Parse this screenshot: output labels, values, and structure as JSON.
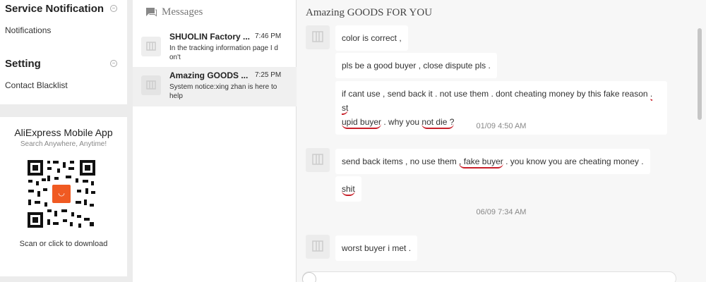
{
  "sidebar": {
    "service": {
      "title": "Service Notification",
      "link": "Notifications"
    },
    "setting": {
      "title": "Setting",
      "link": "Contact Blacklist"
    },
    "app": {
      "title": "AliExpress Mobile App",
      "subtitle": "Search Anywhere, Anytime!",
      "download": "Scan or click to download"
    }
  },
  "messages": {
    "title": "Messages",
    "conversations": [
      {
        "name": "SHUOLIN Factory ...",
        "time": "7:46 PM",
        "preview": "In the tracking information page I d on't"
      },
      {
        "name": "Amazing GOODS ...",
        "time": "7:25 PM",
        "preview": "System notice:xing zhan is here to help"
      }
    ]
  },
  "chat": {
    "title": "Amazing GOODS FOR YOU",
    "messages": [
      {
        "text": "color is correct ,"
      },
      {
        "text": "pls be a good buyer , close dispute pls ."
      },
      {
        "line1_a": "if cant use , send back it . not use them . dont cheating money by this fake reason ",
        "line1_b": ". st",
        "line2_a": "upid buyer",
        "line2_b": " . why you ",
        "line2_c": "not die ?"
      },
      {
        "time": "01/09 4:50 AM"
      },
      {
        "part1": "send back items , no use them ",
        "part2": ", fake buyer",
        "part3": " . you know you are cheating money ."
      },
      {
        "text": "shit"
      },
      {
        "time": "06/09 7:34 AM"
      },
      {
        "text": "worst buyer i met ."
      }
    ]
  }
}
